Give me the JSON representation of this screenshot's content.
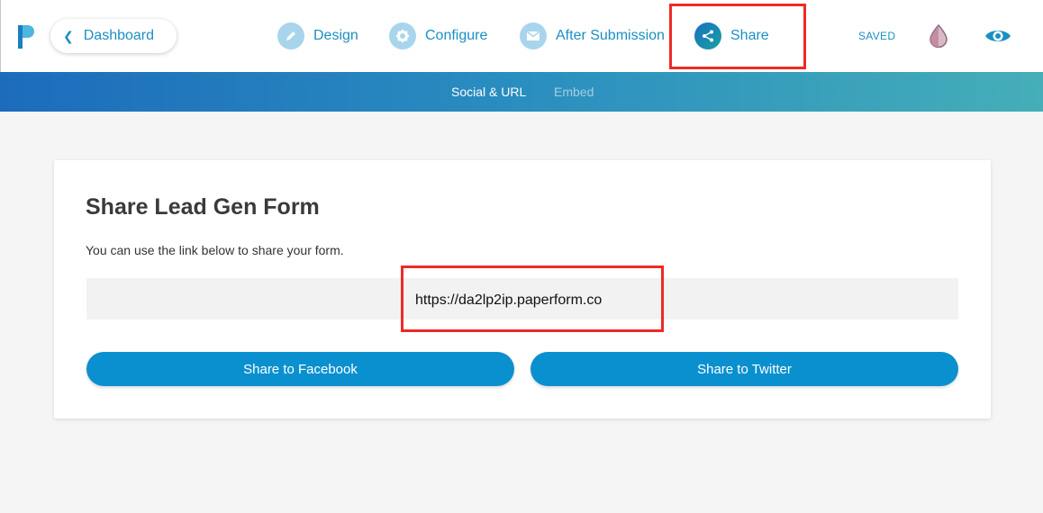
{
  "header": {
    "dashboard_label": "Dashboard",
    "nav": [
      {
        "label": "Design",
        "icon": "pencil-icon"
      },
      {
        "label": "Configure",
        "icon": "gear-icon"
      },
      {
        "label": "After Submission",
        "icon": "envelope-icon"
      },
      {
        "label": "Share",
        "icon": "share-icon",
        "active": true
      }
    ],
    "saved_status": "SAVED"
  },
  "subnav": {
    "tabs": [
      {
        "label": "Social & URL",
        "active": true
      },
      {
        "label": "Embed",
        "active": false
      }
    ]
  },
  "card": {
    "title": "Share Lead Gen Form",
    "description": "You can use the link below to share your form.",
    "url": "https://da2lp2ip.paperform.co",
    "facebook_label": "Share to Facebook",
    "twitter_label": "Share to Twitter"
  },
  "colors": {
    "accent": "#1b8fc4",
    "button": "#0b90cf",
    "highlight": "#ee2a24"
  }
}
